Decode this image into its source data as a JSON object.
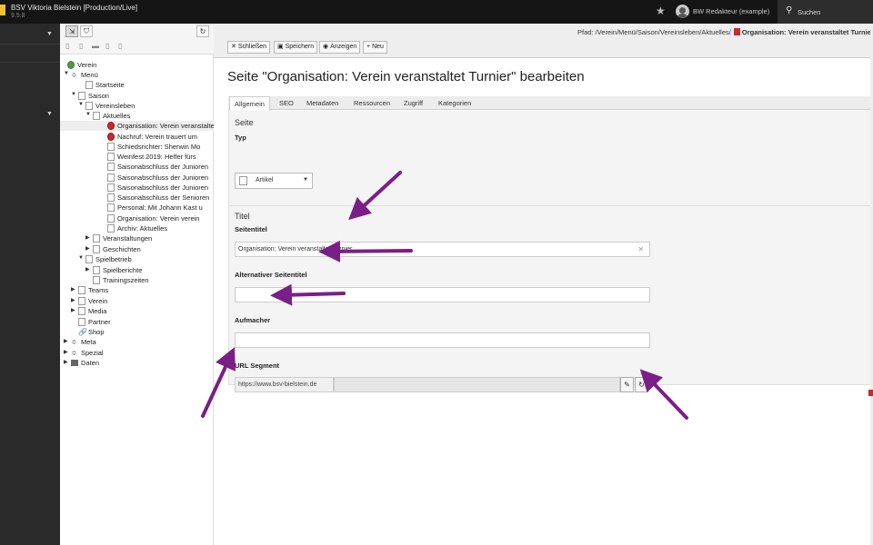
{
  "topbar": {
    "site_name": "BSV Viktoria Bielstein [Production/Live]",
    "version": "9.5.8",
    "user": "BW Redakteur (example)",
    "search_label": "Suchen"
  },
  "tree": {
    "nodes": [
      {
        "label": "Verein",
        "icon": "globe",
        "toggle": ""
      },
      {
        "label": "Menü",
        "icon": "menu",
        "toggle": "▼"
      },
      {
        "label": "Startseite",
        "icon": "page",
        "toggle": ""
      },
      {
        "label": "Saison",
        "icon": "page",
        "toggle": "▼"
      },
      {
        "label": "Vereinsleben",
        "icon": "page",
        "toggle": "▼"
      },
      {
        "label": "Aktuelles",
        "icon": "page",
        "toggle": "▼"
      },
      {
        "label": "Organisation: Verein veranstaltet Turnier",
        "icon": "red",
        "toggle": "",
        "selected": true
      },
      {
        "label": "Nachruf: Verein trauert um",
        "icon": "red",
        "toggle": ""
      },
      {
        "label": "Schiedsrichter: Sherwin Mo",
        "icon": "page",
        "toggle": ""
      },
      {
        "label": "Weinfest 2019: Helfer fürs",
        "icon": "page",
        "toggle": ""
      },
      {
        "label": "Saisonabschluss der Junioren",
        "icon": "page",
        "toggle": ""
      },
      {
        "label": "Saisonabschluss der Junioren",
        "icon": "page",
        "toggle": ""
      },
      {
        "label": "Saisonabschluss der Junioren",
        "icon": "page",
        "toggle": ""
      },
      {
        "label": "Saisonabschluss der Senioren",
        "icon": "page",
        "toggle": ""
      },
      {
        "label": "Personal: Mit Johann Kast u",
        "icon": "page",
        "toggle": ""
      },
      {
        "label": "Organisation: Verein verein",
        "icon": "page",
        "toggle": ""
      },
      {
        "label": "Archiv: Aktuelles",
        "icon": "page",
        "toggle": ""
      },
      {
        "label": "Veranstaltungen",
        "icon": "page",
        "toggle": "▶"
      },
      {
        "label": "Geschichten",
        "icon": "page",
        "toggle": "▶"
      },
      {
        "label": "Spielbetrieb",
        "icon": "page",
        "toggle": "▼"
      },
      {
        "label": "Spielberichte",
        "icon": "page",
        "toggle": "▶"
      },
      {
        "label": "Trainingszeiten",
        "icon": "page",
        "toggle": ""
      },
      {
        "label": "Teams",
        "icon": "page",
        "toggle": "▶"
      },
      {
        "label": "Verein",
        "icon": "page",
        "toggle": "▶"
      },
      {
        "label": "Media",
        "icon": "page",
        "toggle": "▶"
      },
      {
        "label": "Partner",
        "icon": "page",
        "toggle": ""
      },
      {
        "label": "Shop",
        "icon": "link",
        "toggle": ""
      },
      {
        "label": "Meta",
        "icon": "menu",
        "toggle": "▶"
      },
      {
        "label": "Spezial",
        "icon": "menu",
        "toggle": "▶"
      },
      {
        "label": "Daten",
        "icon": "folder",
        "toggle": "▶"
      }
    ]
  },
  "docheader": {
    "path_prefix": "Pfad: /Verein/Menü/Saison/Vereinsleben/Aktuelles/",
    "path_title": "Organisation: Verein veranstaltet Turnier",
    "buttons": {
      "close": "Schließen",
      "save": "Speichern",
      "view": "Anzeigen",
      "new": "Neu"
    }
  },
  "page_title": "Seite \"Organisation: Verein veranstaltet Turnier\" bearbeiten",
  "tabs": [
    "Allgemein",
    "SEO",
    "Metadaten",
    "Ressourcen",
    "Zugriff",
    "Kategorien"
  ],
  "form": {
    "section_page": "Seite",
    "type_label": "Typ",
    "type_value": "Artikel",
    "section_title": "Titel",
    "page_title_label": "Seitentitel",
    "page_title_value": "Organisation: Verein veranstaltet Turnier",
    "alt_title_label": "Alternativer Seitentitel",
    "alt_title_value": "",
    "teaser_label": "Aufmacher",
    "teaser_value": "",
    "url_label": "URL Segment",
    "url_prefix": "https://www.bsv-bielstein.de",
    "url_value": ""
  },
  "colors": {
    "annotation_arrow": "#7a1f86",
    "tab_active": "#ffffff",
    "record_icon": "#c62c2c"
  }
}
